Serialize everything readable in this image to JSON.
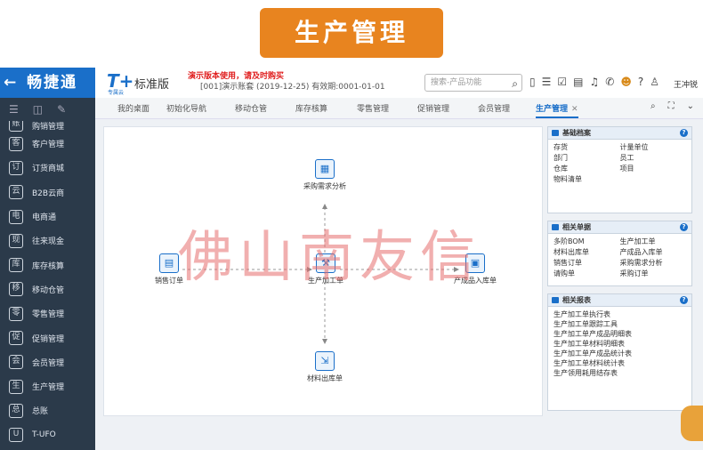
{
  "banner": {
    "title": "生产管理"
  },
  "brand": {
    "name": "畅捷通",
    "arrow": "←"
  },
  "header": {
    "logo_mark": "T+",
    "logo_sub": "专属云",
    "edition": "标准版",
    "demo_warning": "演示版本使用，请及时购买",
    "account_info": "[001]演示账套    (2019-12-25)    有效期:0001-01-01",
    "search_placeholder": "搜索-产品功能",
    "user_name": "王冲锐"
  },
  "sidebar": {
    "items": [
      {
        "label": "购销管理",
        "icon": "ledger-icon",
        "glyph": "账"
      },
      {
        "label": "客户管理",
        "icon": "customer-icon",
        "glyph": "客"
      },
      {
        "label": "订货商城",
        "icon": "shop-icon",
        "glyph": "订"
      },
      {
        "label": "B2B云商",
        "icon": "b2b-icon",
        "glyph": "云"
      },
      {
        "label": "电商通",
        "icon": "ecommerce-icon",
        "glyph": "电"
      },
      {
        "label": "往来现金",
        "icon": "cash-icon",
        "glyph": "现"
      },
      {
        "label": "库存核算",
        "icon": "inventory-icon",
        "glyph": "库"
      },
      {
        "label": "移动仓管",
        "icon": "mobile-warehouse-icon",
        "glyph": "移"
      },
      {
        "label": "零售管理",
        "icon": "retail-icon",
        "glyph": "零"
      },
      {
        "label": "促销管理",
        "icon": "promotion-icon",
        "glyph": "促"
      },
      {
        "label": "会员管理",
        "icon": "member-icon",
        "glyph": "会"
      },
      {
        "label": "生产管理",
        "icon": "production-icon",
        "glyph": "生"
      },
      {
        "label": "总账",
        "icon": "general-ledger-icon",
        "glyph": "总"
      },
      {
        "label": "T-UFO",
        "icon": "ufo-icon",
        "glyph": "U"
      }
    ]
  },
  "tabs": [
    {
      "label": "我的桌面"
    },
    {
      "label": "初始化导航"
    },
    {
      "label": "移动仓管"
    },
    {
      "label": "库存核算"
    },
    {
      "label": "零售管理"
    },
    {
      "label": "促销管理"
    },
    {
      "label": "会员管理"
    },
    {
      "label": "生产管理",
      "active": true
    }
  ],
  "flow": {
    "nodes": {
      "purchase_analysis": "采购需求分析",
      "sales_order": "销售订单",
      "production_order": "生产加工单",
      "finished_goods": "产成品入库单",
      "material_out": "材料出库单"
    }
  },
  "panels": {
    "basic_archive": {
      "title": "基础档案",
      "items": [
        "存货",
        "计量单位",
        "部门",
        "员工",
        "仓库",
        "项目",
        "物料清单"
      ]
    },
    "related_docs": {
      "title": "相关单据",
      "items": [
        "多阶BOM",
        "生产加工单",
        "材料出库单",
        "产成品入库单",
        "销售订单",
        "采购需求分析",
        "请购单",
        "采购订单"
      ]
    },
    "related_reports": {
      "title": "相关报表",
      "items": [
        "生产加工单执行表",
        "生产加工单跟踪工具",
        "生产加工单产成品明细表",
        "生产加工单材料明细表",
        "生产加工单产成品统计表",
        "生产加工单材料统计表",
        "生产领用耗用结存表"
      ]
    }
  },
  "watermark": "佛山南友信",
  "colors": {
    "brand_blue": "#1a6fc9",
    "sidebar_bg": "#2b3a4a",
    "banner_orange": "#e8841f",
    "warning_red": "#e02020"
  }
}
